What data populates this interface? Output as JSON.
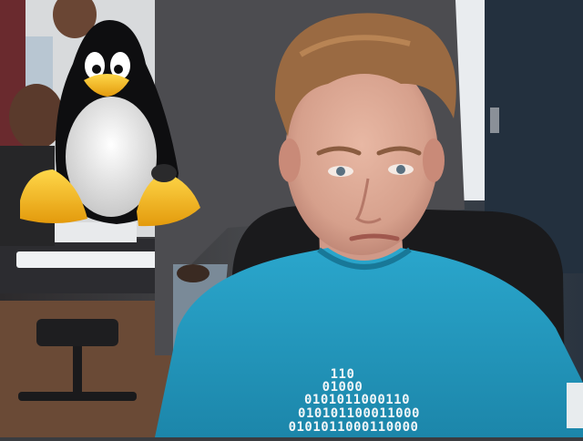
{
  "shirt_print": {
    "lines": [
      "110",
      "01000",
      "0101011000110",
      "010101100011000",
      "0101011000110000"
    ]
  }
}
